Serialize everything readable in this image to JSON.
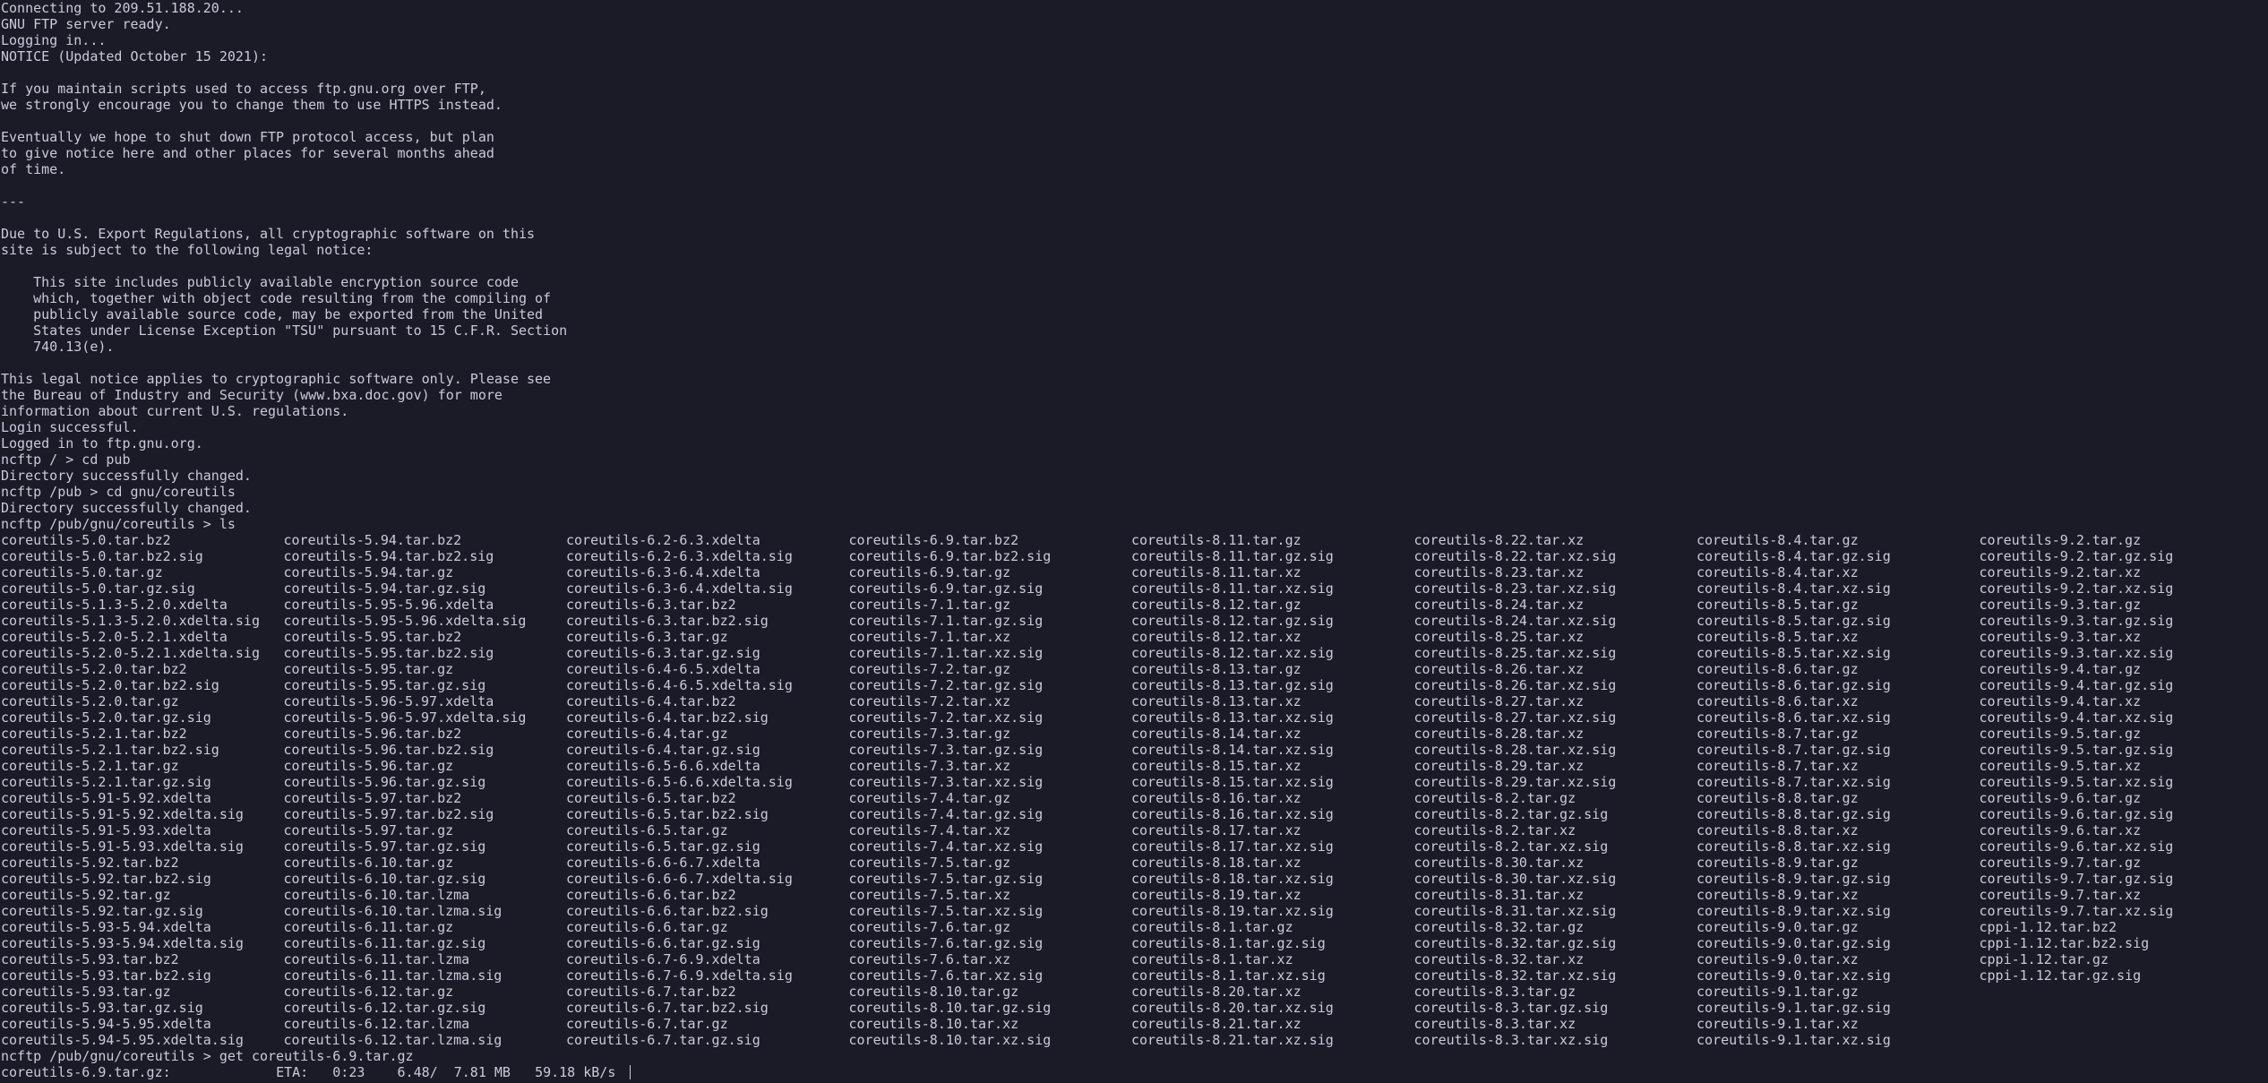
{
  "session": {
    "lines": [
      "Connecting to 209.51.188.20...",
      "GNU FTP server ready.",
      "Logging in...",
      "NOTICE (Updated October 15 2021):",
      "",
      "If you maintain scripts used to access ftp.gnu.org over FTP,",
      "we strongly encourage you to change them to use HTTPS instead.",
      "",
      "Eventually we hope to shut down FTP protocol access, but plan",
      "to give notice here and other places for several months ahead",
      "of time.",
      "",
      "---",
      "",
      "Due to U.S. Export Regulations, all cryptographic software on this",
      "site is subject to the following legal notice:",
      "",
      "    This site includes publicly available encryption source code",
      "    which, together with object code resulting from the compiling of",
      "    publicly available source code, may be exported from the United",
      "    States under License Exception \"TSU\" pursuant to 15 C.F.R. Section",
      "    740.13(e).",
      "",
      "This legal notice applies to cryptographic software only. Please see",
      "the Bureau of Industry and Security (www.bxa.doc.gov) for more",
      "information about current U.S. regulations.",
      "Login successful.",
      "Logged in to ftp.gnu.org.",
      "ncftp / > cd pub",
      "Directory successfully changed.",
      "ncftp /pub > cd gnu/coreutils",
      "Directory successfully changed.",
      "ncftp /pub/gnu/coreutils > ls"
    ],
    "listing_columns": [
      [
        "coreutils-5.0.tar.bz2",
        "coreutils-5.0.tar.bz2.sig",
        "coreutils-5.0.tar.gz",
        "coreutils-5.0.tar.gz.sig",
        "coreutils-5.1.3-5.2.0.xdelta",
        "coreutils-5.1.3-5.2.0.xdelta.sig",
        "coreutils-5.2.0-5.2.1.xdelta",
        "coreutils-5.2.0-5.2.1.xdelta.sig",
        "coreutils-5.2.0.tar.bz2",
        "coreutils-5.2.0.tar.bz2.sig",
        "coreutils-5.2.0.tar.gz",
        "coreutils-5.2.0.tar.gz.sig",
        "coreutils-5.2.1.tar.bz2",
        "coreutils-5.2.1.tar.bz2.sig",
        "coreutils-5.2.1.tar.gz",
        "coreutils-5.2.1.tar.gz.sig",
        "coreutils-5.91-5.92.xdelta",
        "coreutils-5.91-5.92.xdelta.sig",
        "coreutils-5.91-5.93.xdelta",
        "coreutils-5.91-5.93.xdelta.sig",
        "coreutils-5.92.tar.bz2",
        "coreutils-5.92.tar.bz2.sig",
        "coreutils-5.92.tar.gz",
        "coreutils-5.92.tar.gz.sig",
        "coreutils-5.93-5.94.xdelta",
        "coreutils-5.93-5.94.xdelta.sig",
        "coreutils-5.93.tar.bz2",
        "coreutils-5.93.tar.bz2.sig",
        "coreutils-5.93.tar.gz",
        "coreutils-5.93.tar.gz.sig",
        "coreutils-5.94-5.95.xdelta",
        "coreutils-5.94-5.95.xdelta.sig"
      ],
      [
        "coreutils-5.94.tar.bz2",
        "coreutils-5.94.tar.bz2.sig",
        "coreutils-5.94.tar.gz",
        "coreutils-5.94.tar.gz.sig",
        "coreutils-5.95-5.96.xdelta",
        "coreutils-5.95-5.96.xdelta.sig",
        "coreutils-5.95.tar.bz2",
        "coreutils-5.95.tar.bz2.sig",
        "coreutils-5.95.tar.gz",
        "coreutils-5.95.tar.gz.sig",
        "coreutils-5.96-5.97.xdelta",
        "coreutils-5.96-5.97.xdelta.sig",
        "coreutils-5.96.tar.bz2",
        "coreutils-5.96.tar.bz2.sig",
        "coreutils-5.96.tar.gz",
        "coreutils-5.96.tar.gz.sig",
        "coreutils-5.97.tar.bz2",
        "coreutils-5.97.tar.bz2.sig",
        "coreutils-5.97.tar.gz",
        "coreutils-5.97.tar.gz.sig",
        "coreutils-6.10.tar.gz",
        "coreutils-6.10.tar.gz.sig",
        "coreutils-6.10.tar.lzma",
        "coreutils-6.10.tar.lzma.sig",
        "coreutils-6.11.tar.gz",
        "coreutils-6.11.tar.gz.sig",
        "coreutils-6.11.tar.lzma",
        "coreutils-6.11.tar.lzma.sig",
        "coreutils-6.12.tar.gz",
        "coreutils-6.12.tar.gz.sig",
        "coreutils-6.12.tar.lzma",
        "coreutils-6.12.tar.lzma.sig"
      ],
      [
        "coreutils-6.2-6.3.xdelta",
        "coreutils-6.2-6.3.xdelta.sig",
        "coreutils-6.3-6.4.xdelta",
        "coreutils-6.3-6.4.xdelta.sig",
        "coreutils-6.3.tar.bz2",
        "coreutils-6.3.tar.bz2.sig",
        "coreutils-6.3.tar.gz",
        "coreutils-6.3.tar.gz.sig",
        "coreutils-6.4-6.5.xdelta",
        "coreutils-6.4-6.5.xdelta.sig",
        "coreutils-6.4.tar.bz2",
        "coreutils-6.4.tar.bz2.sig",
        "coreutils-6.4.tar.gz",
        "coreutils-6.4.tar.gz.sig",
        "coreutils-6.5-6.6.xdelta",
        "coreutils-6.5-6.6.xdelta.sig",
        "coreutils-6.5.tar.bz2",
        "coreutils-6.5.tar.bz2.sig",
        "coreutils-6.5.tar.gz",
        "coreutils-6.5.tar.gz.sig",
        "coreutils-6.6-6.7.xdelta",
        "coreutils-6.6-6.7.xdelta.sig",
        "coreutils-6.6.tar.bz2",
        "coreutils-6.6.tar.bz2.sig",
        "coreutils-6.6.tar.gz",
        "coreutils-6.6.tar.gz.sig",
        "coreutils-6.7-6.9.xdelta",
        "coreutils-6.7-6.9.xdelta.sig",
        "coreutils-6.7.tar.bz2",
        "coreutils-6.7.tar.bz2.sig",
        "coreutils-6.7.tar.gz",
        "coreutils-6.7.tar.gz.sig"
      ],
      [
        "coreutils-6.9.tar.bz2",
        "coreutils-6.9.tar.bz2.sig",
        "coreutils-6.9.tar.gz",
        "coreutils-6.9.tar.gz.sig",
        "coreutils-7.1.tar.gz",
        "coreutils-7.1.tar.gz.sig",
        "coreutils-7.1.tar.xz",
        "coreutils-7.1.tar.xz.sig",
        "coreutils-7.2.tar.gz",
        "coreutils-7.2.tar.gz.sig",
        "coreutils-7.2.tar.xz",
        "coreutils-7.2.tar.xz.sig",
        "coreutils-7.3.tar.gz",
        "coreutils-7.3.tar.gz.sig",
        "coreutils-7.3.tar.xz",
        "coreutils-7.3.tar.xz.sig",
        "coreutils-7.4.tar.gz",
        "coreutils-7.4.tar.gz.sig",
        "coreutils-7.4.tar.xz",
        "coreutils-7.4.tar.xz.sig",
        "coreutils-7.5.tar.gz",
        "coreutils-7.5.tar.gz.sig",
        "coreutils-7.5.tar.xz",
        "coreutils-7.5.tar.xz.sig",
        "coreutils-7.6.tar.gz",
        "coreutils-7.6.tar.gz.sig",
        "coreutils-7.6.tar.xz",
        "coreutils-7.6.tar.xz.sig",
        "coreutils-8.10.tar.gz",
        "coreutils-8.10.tar.gz.sig",
        "coreutils-8.10.tar.xz",
        "coreutils-8.10.tar.xz.sig"
      ],
      [
        "coreutils-8.11.tar.gz",
        "coreutils-8.11.tar.gz.sig",
        "coreutils-8.11.tar.xz",
        "coreutils-8.11.tar.xz.sig",
        "coreutils-8.12.tar.gz",
        "coreutils-8.12.tar.gz.sig",
        "coreutils-8.12.tar.xz",
        "coreutils-8.12.tar.xz.sig",
        "coreutils-8.13.tar.gz",
        "coreutils-8.13.tar.gz.sig",
        "coreutils-8.13.tar.xz",
        "coreutils-8.13.tar.xz.sig",
        "coreutils-8.14.tar.xz",
        "coreutils-8.14.tar.xz.sig",
        "coreutils-8.15.tar.xz",
        "coreutils-8.15.tar.xz.sig",
        "coreutils-8.16.tar.xz",
        "coreutils-8.16.tar.xz.sig",
        "coreutils-8.17.tar.xz",
        "coreutils-8.17.tar.xz.sig",
        "coreutils-8.18.tar.xz",
        "coreutils-8.18.tar.xz.sig",
        "coreutils-8.19.tar.xz",
        "coreutils-8.19.tar.xz.sig",
        "coreutils-8.1.tar.gz",
        "coreutils-8.1.tar.gz.sig",
        "coreutils-8.1.tar.xz",
        "coreutils-8.1.tar.xz.sig",
        "coreutils-8.20.tar.xz",
        "coreutils-8.20.tar.xz.sig",
        "coreutils-8.21.tar.xz",
        "coreutils-8.21.tar.xz.sig"
      ],
      [
        "coreutils-8.22.tar.xz",
        "coreutils-8.22.tar.xz.sig",
        "coreutils-8.23.tar.xz",
        "coreutils-8.23.tar.xz.sig",
        "coreutils-8.24.tar.xz",
        "coreutils-8.24.tar.xz.sig",
        "coreutils-8.25.tar.xz",
        "coreutils-8.25.tar.xz.sig",
        "coreutils-8.26.tar.xz",
        "coreutils-8.26.tar.xz.sig",
        "coreutils-8.27.tar.xz",
        "coreutils-8.27.tar.xz.sig",
        "coreutils-8.28.tar.xz",
        "coreutils-8.28.tar.xz.sig",
        "coreutils-8.29.tar.xz",
        "coreutils-8.29.tar.xz.sig",
        "coreutils-8.2.tar.gz",
        "coreutils-8.2.tar.gz.sig",
        "coreutils-8.2.tar.xz",
        "coreutils-8.2.tar.xz.sig",
        "coreutils-8.30.tar.xz",
        "coreutils-8.30.tar.xz.sig",
        "coreutils-8.31.tar.xz",
        "coreutils-8.31.tar.xz.sig",
        "coreutils-8.32.tar.gz",
        "coreutils-8.32.tar.gz.sig",
        "coreutils-8.32.tar.xz",
        "coreutils-8.32.tar.xz.sig",
        "coreutils-8.3.tar.gz",
        "coreutils-8.3.tar.gz.sig",
        "coreutils-8.3.tar.xz",
        "coreutils-8.3.tar.xz.sig"
      ],
      [
        "coreutils-8.4.tar.gz",
        "coreutils-8.4.tar.gz.sig",
        "coreutils-8.4.tar.xz",
        "coreutils-8.4.tar.xz.sig",
        "coreutils-8.5.tar.gz",
        "coreutils-8.5.tar.gz.sig",
        "coreutils-8.5.tar.xz",
        "coreutils-8.5.tar.xz.sig",
        "coreutils-8.6.tar.gz",
        "coreutils-8.6.tar.gz.sig",
        "coreutils-8.6.tar.xz",
        "coreutils-8.6.tar.xz.sig",
        "coreutils-8.7.tar.gz",
        "coreutils-8.7.tar.gz.sig",
        "coreutils-8.7.tar.xz",
        "coreutils-8.7.tar.xz.sig",
        "coreutils-8.8.tar.gz",
        "coreutils-8.8.tar.gz.sig",
        "coreutils-8.8.tar.xz",
        "coreutils-8.8.tar.xz.sig",
        "coreutils-8.9.tar.gz",
        "coreutils-8.9.tar.gz.sig",
        "coreutils-8.9.tar.xz",
        "coreutils-8.9.tar.xz.sig",
        "coreutils-9.0.tar.gz",
        "coreutils-9.0.tar.gz.sig",
        "coreutils-9.0.tar.xz",
        "coreutils-9.0.tar.xz.sig",
        "coreutils-9.1.tar.gz",
        "coreutils-9.1.tar.gz.sig",
        "coreutils-9.1.tar.xz",
        "coreutils-9.1.tar.xz.sig"
      ],
      [
        "coreutils-9.2.tar.gz",
        "coreutils-9.2.tar.gz.sig",
        "coreutils-9.2.tar.xz",
        "coreutils-9.2.tar.xz.sig",
        "coreutils-9.3.tar.gz",
        "coreutils-9.3.tar.gz.sig",
        "coreutils-9.3.tar.xz",
        "coreutils-9.3.tar.xz.sig",
        "coreutils-9.4.tar.gz",
        "coreutils-9.4.tar.gz.sig",
        "coreutils-9.4.tar.xz",
        "coreutils-9.4.tar.xz.sig",
        "coreutils-9.5.tar.gz",
        "coreutils-9.5.tar.gz.sig",
        "coreutils-9.5.tar.xz",
        "coreutils-9.5.tar.xz.sig",
        "coreutils-9.6.tar.gz",
        "coreutils-9.6.tar.gz.sig",
        "coreutils-9.6.tar.xz",
        "coreutils-9.6.tar.xz.sig",
        "coreutils-9.7.tar.gz",
        "coreutils-9.7.tar.gz.sig",
        "coreutils-9.7.tar.xz",
        "coreutils-9.7.tar.xz.sig",
        "cppi-1.12.tar.bz2",
        "cppi-1.12.tar.bz2.sig",
        "cppi-1.12.tar.gz",
        "cppi-1.12.tar.gz.sig"
      ]
    ],
    "get_command": "ncftp /pub/gnu/coreutils > get coreutils-6.9.tar.gz",
    "progress": {
      "file": "coreutils-6.9.tar.gz:",
      "eta_label": "ETA:",
      "eta": "0:23",
      "transferred": "6.48/",
      "total": "7.81 MB",
      "rate": "59.18 kB/s"
    }
  },
  "colors": {
    "background": "#1a1b26",
    "foreground": "#c8cbdb"
  }
}
